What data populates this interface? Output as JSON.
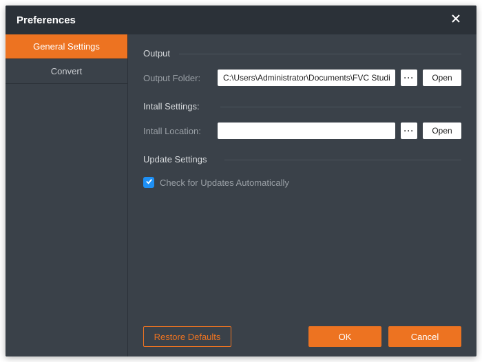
{
  "title": "Preferences",
  "sidebar": {
    "tabs": [
      {
        "label": "General Settings",
        "active": true
      },
      {
        "label": "Convert",
        "active": false
      }
    ]
  },
  "sections": {
    "output": {
      "title": "Output",
      "folder_label": "Output Folder:",
      "folder_value": "C:\\Users\\Administrator\\Documents\\FVC Studio\\",
      "browse": "···",
      "open": "Open"
    },
    "install": {
      "title": "Intall Settings:",
      "location_label": "Intall Location:",
      "location_value": "",
      "browse": "···",
      "open": "Open"
    },
    "update": {
      "title": "Update Settings",
      "checkbox_label": "Check for Updates Automatically",
      "checked": true
    }
  },
  "footer": {
    "restore": "Restore Defaults",
    "ok": "OK",
    "cancel": "Cancel"
  },
  "colors": {
    "accent": "#ed7321",
    "bg": "#3a4149",
    "titlebar": "#2b3138",
    "check": "#1e90f5"
  }
}
